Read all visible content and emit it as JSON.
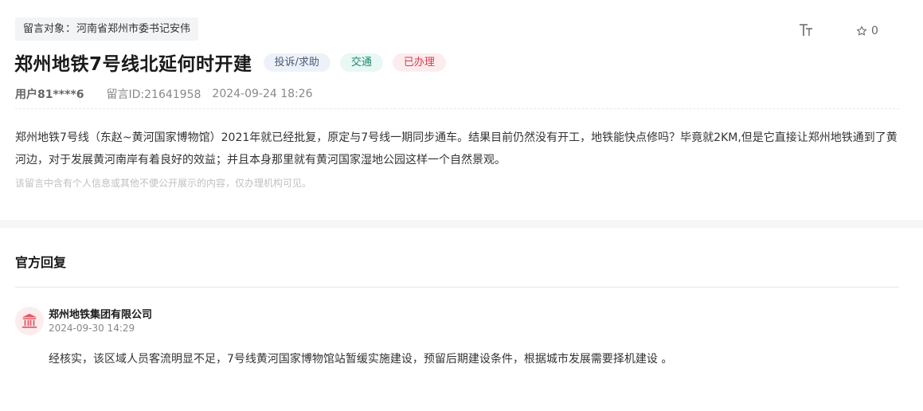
{
  "message": {
    "target_label": "留言对象",
    "target_sep": "：",
    "target_value": "河南省郑州市委书记安伟",
    "title": "郑州地铁7号线北延何时开建",
    "badges": {
      "type": "投诉/求助",
      "category": "交通",
      "status": "已办理"
    },
    "user": "用户81****6",
    "message_id": "留言ID:21641958",
    "datetime": "2024-09-24 18:26",
    "content": "郑州地铁7号线（东赵~黄河国家博物馆）2021年就已经批复，原定与7号线一期同步通车。结果目前仍然没有开工，地铁能快点修吗？毕竟就2KM,但是它直接让郑州地铁通到了黄河边，对于发展黄河南岸有着良好的效益；并且本身那里就有黄河国家湿地公园这样一个自然景观。",
    "privacy_note": "该留言中含有个人信息或其他不便公开展示的内容，仅办理机构可见。"
  },
  "toolbar": {
    "font_icon": "font-size-icon",
    "star_icon": "star-icon",
    "star_count": "0"
  },
  "reply": {
    "heading": "官方回复",
    "avatar_icon": "government-building-icon",
    "org_name": "郑州地铁集团有限公司",
    "datetime": "2024-09-30 14:29",
    "text": "经核实，该区域人员客流明显不足，7号线黄河国家博物馆站暂缓实施建设，预留后期建设条件，根据城市发展需要择机建设 。"
  },
  "colors": {
    "status_red": "#d93a4a",
    "category_green": "#1e8a70",
    "type_blue": "#4a5a7a"
  }
}
